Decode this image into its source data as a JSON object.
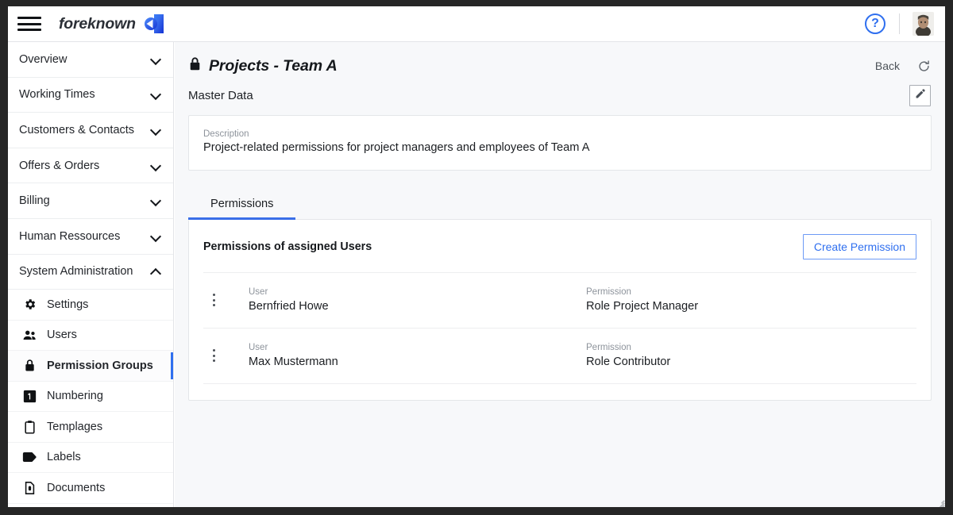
{
  "topbar": {
    "menu_icon": "hamburger-icon",
    "brand_name": "foreknown",
    "logo_icon": "foreknown-logo-icon",
    "help_icon": "?",
    "avatar_icon": "user-avatar"
  },
  "sidebar": {
    "groups": [
      {
        "label": "Overview",
        "expanded": false,
        "chevron": "chevron-down-icon"
      },
      {
        "label": "Working Times",
        "expanded": false,
        "chevron": "chevron-down-icon"
      },
      {
        "label": "Customers & Contacts",
        "expanded": false,
        "chevron": "chevron-down-icon"
      },
      {
        "label": "Offers & Orders",
        "expanded": false,
        "chevron": "chevron-down-icon"
      },
      {
        "label": "Billing",
        "expanded": false,
        "chevron": "chevron-down-icon"
      },
      {
        "label": "Human Ressources",
        "expanded": false,
        "chevron": "chevron-down-icon"
      },
      {
        "label": "System Administration",
        "expanded": true,
        "chevron": "chevron-up-icon"
      }
    ],
    "sub_items": [
      {
        "label": "Settings",
        "icon": "gear-icon",
        "active": false
      },
      {
        "label": "Users",
        "icon": "users-icon",
        "active": false
      },
      {
        "label": "Permission Groups",
        "icon": "lock-icon",
        "active": true
      },
      {
        "label": "Numbering",
        "icon": "number-one-icon",
        "active": false
      },
      {
        "label": "Templages",
        "icon": "clipboard-icon",
        "active": false
      },
      {
        "label": "Labels",
        "icon": "tag-icon",
        "active": false
      },
      {
        "label": "Documents",
        "icon": "document-icon",
        "active": false
      }
    ]
  },
  "page": {
    "title": "Projects - Team A",
    "title_icon": "lock-icon",
    "back_label": "Back",
    "refresh_icon": "refresh-icon",
    "section_label": "Master Data",
    "edit_icon": "pencil-icon"
  },
  "description": {
    "label": "Description",
    "value": "Project-related permissions for project managers and employees of Team A"
  },
  "tabs": [
    {
      "label": "Permissions",
      "active": true
    }
  ],
  "permissions": {
    "heading": "Permissions of assigned Users",
    "create_button": "Create Permission",
    "columns": {
      "user": "User",
      "permission": "Permission"
    },
    "rows": [
      {
        "menu_icon": "kebab-menu-icon",
        "user": "Bernfried Howe",
        "permission": "Role Project Manager"
      },
      {
        "menu_icon": "kebab-menu-icon",
        "user": "Max Mustermann",
        "permission": "Role Contributor"
      }
    ]
  },
  "colors": {
    "accent_blue": "#2f6fef",
    "tab_underline": "#3a6fe8",
    "muted_label": "#8d939b",
    "page_bg": "#f7f8fa",
    "window_frame": "#262626"
  }
}
